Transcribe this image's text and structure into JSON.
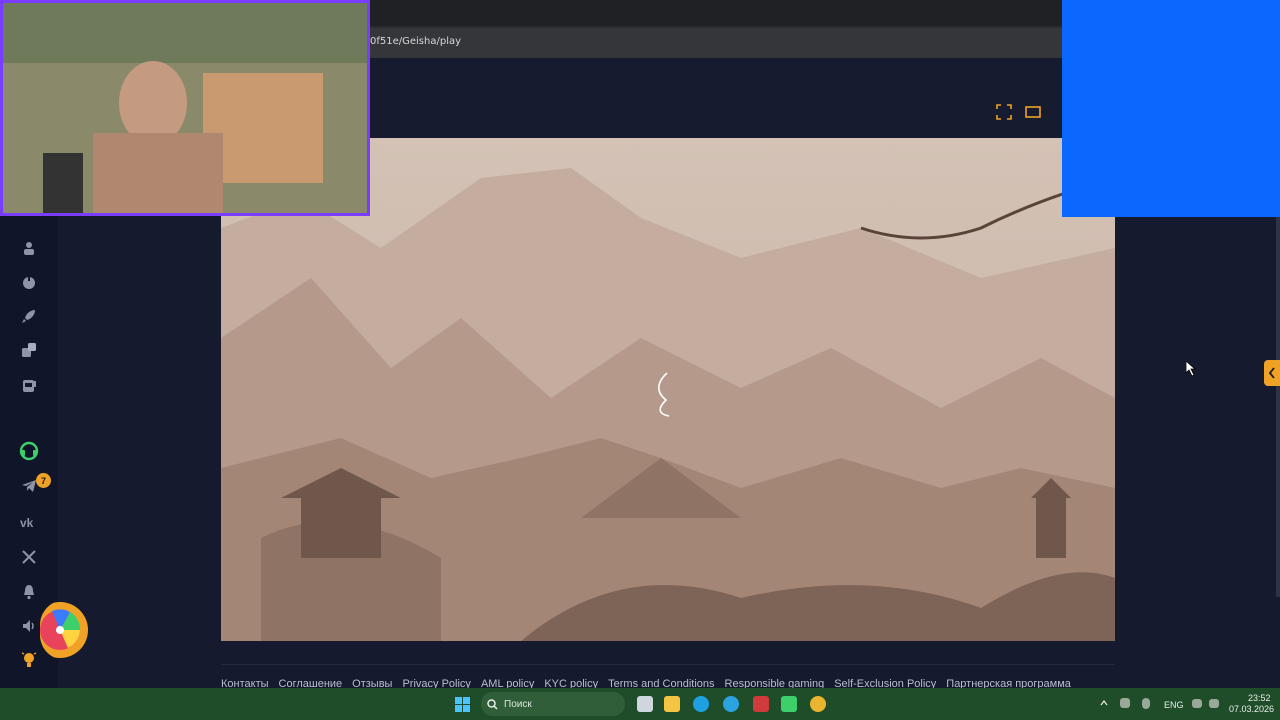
{
  "browser": {
    "url_fragment": "0f51e/Geisha/play"
  },
  "header": {
    "fullscreen_icon": "fullscreen-icon",
    "theater_icon": "theater-mode-icon"
  },
  "sidebar": {
    "icons": [
      "people-icon",
      "joystick-icon",
      "rocket-icon",
      "dice-icon",
      "slot-machine-icon",
      "support-headset-icon",
      "telegram-icon",
      "vk-icon",
      "x-icon",
      "bell-icon",
      "sound-icon",
      "lightbulb-icon"
    ],
    "telegram_badge": "7",
    "accent_green": "#3ccf6a",
    "accent_orange": "#f0a226"
  },
  "footer": {
    "links": [
      "Контакты",
      "Соглашение",
      "Отзывы",
      "Privacy Policy",
      "AML policy",
      "KYC policy",
      "Terms and Conditions",
      "Responsible gaming",
      "Self-Exclusion Policy",
      "Партнерская программа"
    ]
  },
  "taskbar": {
    "search_placeholder": "Поиск",
    "language": "ENG",
    "time": "23:52",
    "date": "07.03.2026"
  },
  "colors": {
    "page_bg": "#151a2e",
    "overlay_blue": "#0a67ff",
    "webcam_border": "#7a3cff"
  }
}
